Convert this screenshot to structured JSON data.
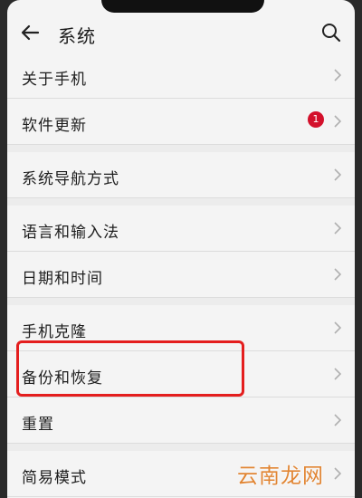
{
  "header": {
    "title": "系统"
  },
  "items": [
    {
      "label": "关于手机"
    },
    {
      "label": "软件更新",
      "badge": "1"
    },
    {
      "label": "系统导航方式"
    },
    {
      "label": "语言和输入法"
    },
    {
      "label": "日期和时间"
    },
    {
      "label": "手机克隆"
    },
    {
      "label": "备份和恢复"
    },
    {
      "label": "重置"
    },
    {
      "label": "简易模式"
    }
  ],
  "watermark": "云南龙网",
  "colors": {
    "badge": "#d3102b",
    "highlight": "#e41e1e",
    "watermark": "#e07a1f"
  }
}
